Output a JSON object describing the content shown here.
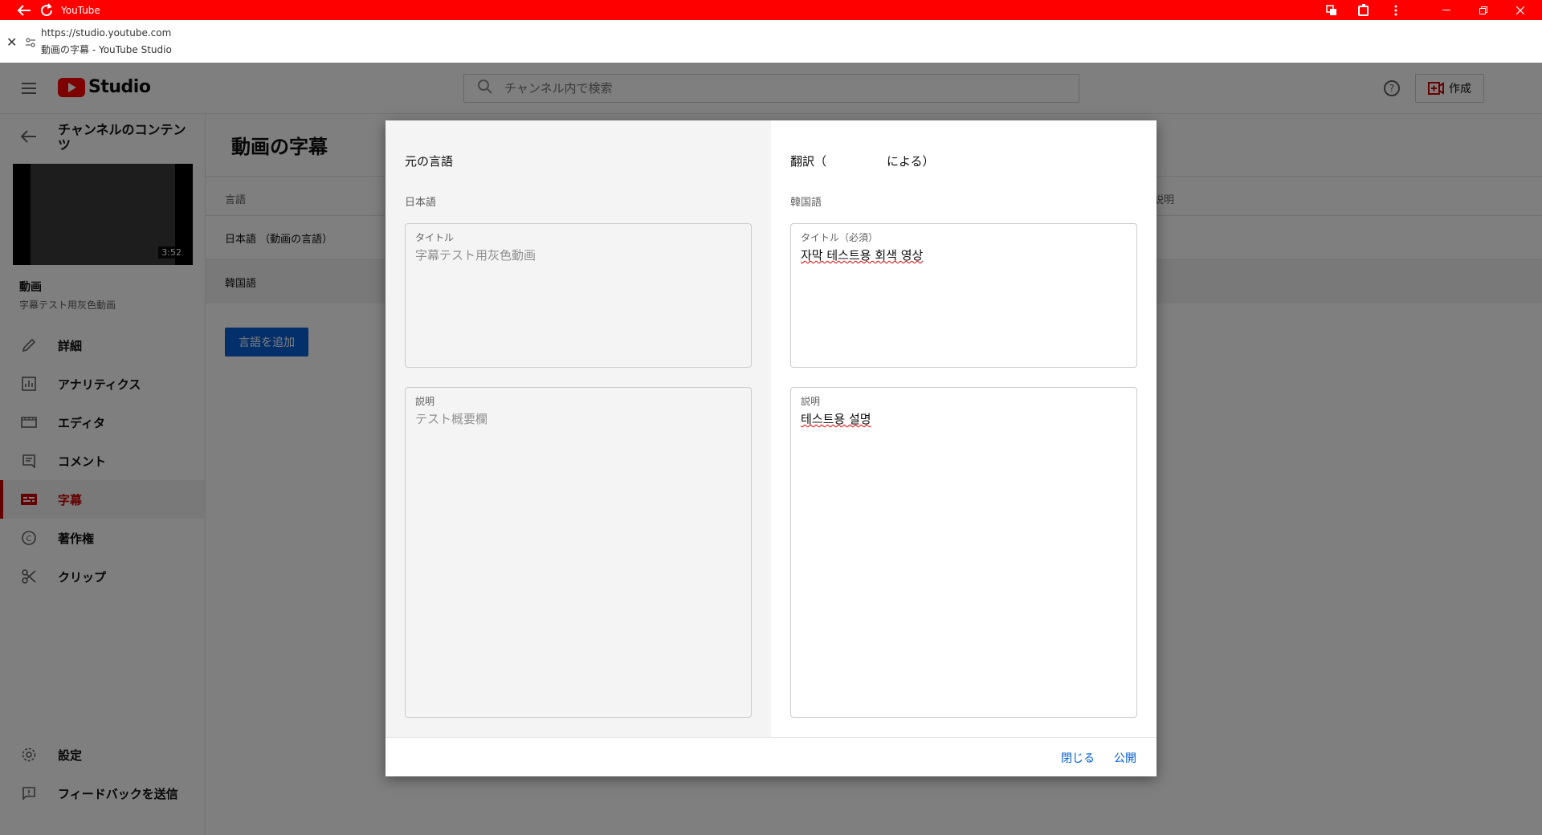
{
  "browser": {
    "tab_title": "YouTube",
    "url": "https://studio.youtube.com",
    "page_title": "動画の字幕 - YouTube Studio"
  },
  "header": {
    "logo_text": "Studio",
    "search_placeholder": "チャンネル内で検索",
    "help_label": "?",
    "create_label": "作成"
  },
  "sidebar": {
    "channel_title": "チャンネルのコンテンツ",
    "video_duration": "3:52",
    "video_section_label": "動画",
    "video_name": "字幕テスト用灰色動画",
    "items": [
      {
        "label": "詳細",
        "icon": "pencil-icon",
        "active": false
      },
      {
        "label": "アナリティクス",
        "icon": "analytics-icon",
        "active": false
      },
      {
        "label": "エディタ",
        "icon": "editor-icon",
        "active": false
      },
      {
        "label": "コメント",
        "icon": "comment-icon",
        "active": false
      },
      {
        "label": "字幕",
        "icon": "subtitles-icon",
        "active": true
      },
      {
        "label": "著作権",
        "icon": "copyright-icon",
        "active": false
      },
      {
        "label": "クリップ",
        "icon": "scissors-icon",
        "active": false
      }
    ],
    "bottom_items": [
      {
        "label": "設定",
        "icon": "gear-icon"
      },
      {
        "label": "フィードバックを送信",
        "icon": "feedback-icon"
      }
    ]
  },
  "main": {
    "title": "動画の字幕",
    "column_language": "言語",
    "column_desc_partial": "説明",
    "rows": [
      "日本語 （動画の言語）",
      "韓国語"
    ],
    "add_language_label": "言語を追加"
  },
  "dialog": {
    "original": {
      "heading": "元の言語",
      "language": "日本語",
      "title_label": "タイトル",
      "title_value": "字幕テスト用灰色動画",
      "desc_label": "説明",
      "desc_value": "テスト概要欄"
    },
    "translation": {
      "heading": "翻訳（　　　　　による）",
      "language": "韓国語",
      "title_label": "タイトル（必須）",
      "title_value": "자막 테스트용 회색 영상",
      "desc_label": "説明",
      "desc_value": "테스트용 설명"
    },
    "close_label": "閉じる",
    "publish_label": "公開"
  },
  "colors": {
    "brand": "#ff0000",
    "active_nav": "#cc0000",
    "link": "#065fd4"
  }
}
